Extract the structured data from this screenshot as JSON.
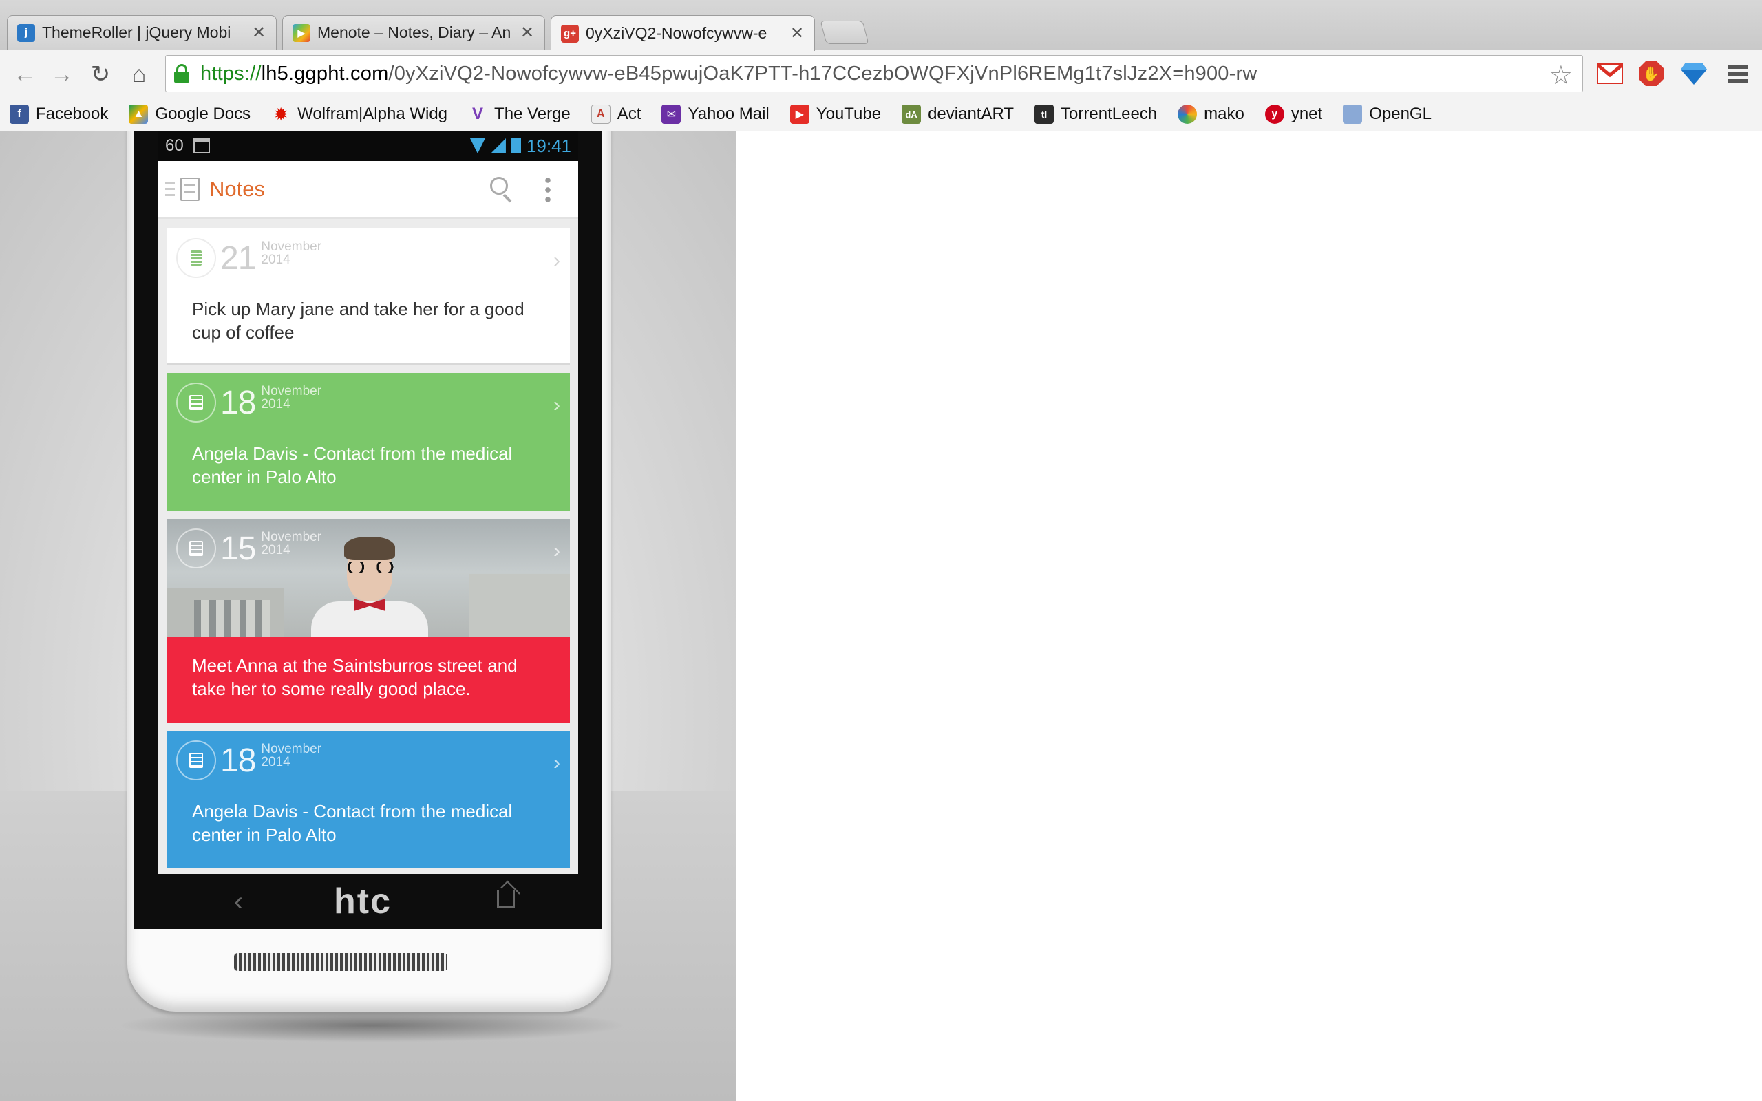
{
  "browser": {
    "tabs": [
      {
        "title": "ThemeRoller | jQuery Mobi",
        "favicon": "jquery-favicon",
        "active": false
      },
      {
        "title": "Menote – Notes, Diary – An",
        "favicon": "google-play-favicon",
        "active": false
      },
      {
        "title": "0yXziVQ2-Nowofcywvw-e",
        "favicon": "google-plus-favicon",
        "active": true
      }
    ],
    "url": {
      "scheme": "https://",
      "host": "lh5.ggpht.com",
      "path": "/0yXziVQ2-Nowofcywvw-eB45pwujOaK7PTT-h17CCezbOWQFXjVnPl6REMg1t7slJz2X=h900-rw"
    },
    "bookmarks": [
      {
        "label": "Facebook",
        "icon": "facebook-icon",
        "color": "#3b5998",
        "glyph": "f"
      },
      {
        "label": "Google Docs",
        "icon": "google-drive-icon",
        "color": "#f4b400",
        "glyph": "▲"
      },
      {
        "label": "Wolfram|Alpha Widg",
        "icon": "wolfram-icon",
        "color": "#dd1100",
        "glyph": "✹"
      },
      {
        "label": "The Verge",
        "icon": "verge-icon",
        "color": "#7b3fb8",
        "glyph": "V"
      },
      {
        "label": "Act",
        "icon": "act-icon",
        "color": "#c0392b",
        "glyph": "A"
      },
      {
        "label": "Yahoo Mail",
        "icon": "yahoo-mail-icon",
        "color": "#6b2fa5",
        "glyph": "✉"
      },
      {
        "label": "YouTube",
        "icon": "youtube-icon",
        "color": "#e52d27",
        "glyph": "▶"
      },
      {
        "label": "deviantART",
        "icon": "deviantart-icon",
        "color": "#6d8b3f",
        "glyph": "dA"
      },
      {
        "label": "TorrentLeech",
        "icon": "torrentleech-icon",
        "color": "#2c2c2c",
        "glyph": "tl"
      },
      {
        "label": "mako",
        "icon": "mako-icon",
        "color": "#2a7ad0",
        "glyph": "m"
      },
      {
        "label": "ynet",
        "icon": "ynet-icon",
        "color": "#d0021b",
        "glyph": "y"
      },
      {
        "label": "OpenGL",
        "icon": "folder-icon",
        "color": "#8aa9d6",
        "glyph": ""
      }
    ]
  },
  "phone": {
    "status": {
      "left": "60",
      "time": "19:41"
    },
    "app_title": "Notes",
    "brand": "htc",
    "notes": [
      {
        "day": "21",
        "month": "November",
        "year": "2014",
        "text": "Pick up Mary jane and take her for a good cup of coffee",
        "color": "#ffffff"
      },
      {
        "day": "18",
        "month": "November",
        "year": "2014",
        "text": "Angela Davis - Contact from the medical center in Palo Alto",
        "color": "#7bc86a"
      },
      {
        "day": "15",
        "month": "November",
        "year": "2014",
        "text": "Meet Anna at the Saintsburros street and take her to some really good place.",
        "color": "#f0263f"
      },
      {
        "day": "18",
        "month": "November",
        "year": "2014",
        "text": "Angela Davis - Contact from the medical center in Palo Alto",
        "color": "#3a9edb"
      }
    ]
  }
}
